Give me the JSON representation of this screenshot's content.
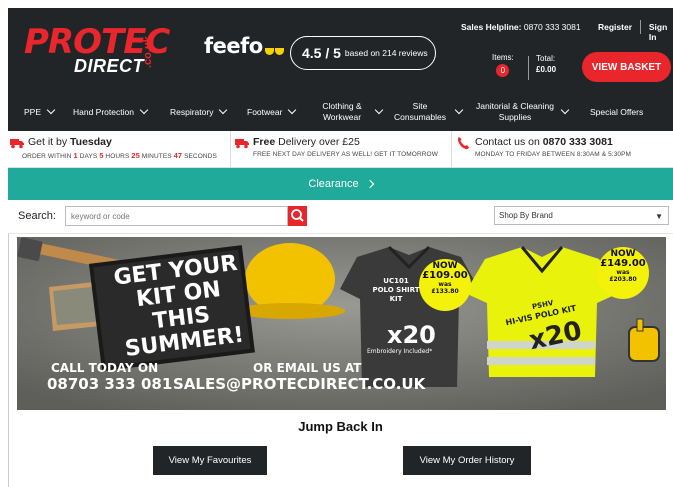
{
  "header": {
    "logo_main": "PROTEC",
    "logo_sub": "DIRECT",
    "logo_suffix": ".co.uk",
    "feefo": "feefo",
    "rating_score": "4.5 / 5",
    "rating_reviews": "based on 214 reviews",
    "helpline_label": "Sales Helpline:",
    "helpline_number": "0870 333 3081",
    "register": "Register",
    "sign_in": "Sign In",
    "items_label": "Items:",
    "items_count": "0",
    "total_label": "Total:",
    "total_value": "£0.00",
    "basket_button": "VIEW BASKET"
  },
  "nav": {
    "items": [
      {
        "label": "PPE"
      },
      {
        "label": "Hand Protection"
      },
      {
        "label": "Respiratory"
      },
      {
        "label": "Footwear"
      },
      {
        "label": "Clothing & Workwear"
      },
      {
        "label": "Site Consumables"
      },
      {
        "label": "Janitorial & Cleaning Supplies"
      },
      {
        "label": "Special Offers"
      }
    ]
  },
  "usp": {
    "delivery_prefix": "Get it by",
    "delivery_day": "Tuesday",
    "order_within": "ORDER WITHIN",
    "days": "1",
    "days_label": "DAYS",
    "hours": "5",
    "hours_label": "HOURS",
    "minutes": "25",
    "minutes_label": "MINUTES",
    "seconds": "47",
    "seconds_label": "SECONDS",
    "free_bold": "Free",
    "free_rest": "Delivery over £25",
    "free_sub": "FREE NEXT DAY DELIVERY AS WELL! GET IT TOMORROW",
    "contact_prefix": "Contact us on",
    "contact_number": "0870 333 3081",
    "contact_sub": "MONDAY TO FRIDAY BETWEEN 8:30AM & 5:30PM"
  },
  "clearance": {
    "label": "Clearance"
  },
  "search": {
    "label": "Search:",
    "placeholder": "keyword or code",
    "brand_select": "Shop By Brand"
  },
  "banner": {
    "headline_1": "GET YOUR",
    "headline_2": "KIT ON THIS",
    "headline_3": "SUMMER!",
    "call_label": "CALL TODAY ON",
    "call_number": "08703 333 081",
    "email_label": "OR EMAIL US AT",
    "email": "SALES@PROTECDIRECT.CO.UK",
    "polo_code": "UC101",
    "polo_name_1": "POLO SHIRT",
    "polo_name_2": "KIT",
    "polo_qty": "x20",
    "polo_note": "Embroidery Included*",
    "polo_now": "NOW",
    "polo_price": "£109.00",
    "polo_was": "was",
    "polo_was_price": "£133.80",
    "hivis_code": "PSHV",
    "hivis_name": "HI-VIS POLO KIT",
    "hivis_qty": "x20",
    "hivis_now": "NOW",
    "hivis_price": "£149.00",
    "hivis_was": "was",
    "hivis_was_price": "£203.80"
  },
  "jump": {
    "title": "Jump Back In",
    "favourites": "View My Favourites",
    "order_history": "View My Order History"
  },
  "colors": {
    "brand_red": "#e8262b",
    "header_dark": "#222528",
    "teal": "#20aa99"
  }
}
